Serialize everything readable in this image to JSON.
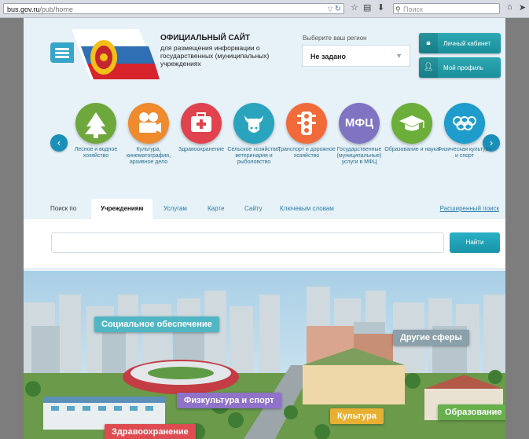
{
  "browser": {
    "url_domain": "bus.gov.ru",
    "url_path": "/pub/home",
    "search_placeholder": "Поиск"
  },
  "header": {
    "title": "ОФИЦИАЛЬНЫЙ САЙТ",
    "subtitle": "для размещения информации о государственных (муниципальных) учреждениях",
    "region_label": "Выберите ваш регион",
    "region_value": "Не задано",
    "cabinet_label": "Личный кабинет",
    "profile_label": "Мой профиль"
  },
  "categories": [
    {
      "label": "Лесное и водное хозяйство",
      "color": "#6ea83c",
      "icon": "tree-icon"
    },
    {
      "label": "Культура, кинематография, архивное дело",
      "color": "#ef8a2d",
      "icon": "camera-icon"
    },
    {
      "label": "Здравоохранение",
      "color": "#e0434e",
      "icon": "medkit-icon"
    },
    {
      "label": "Сельское хозяйство, ветеринария и рыболовство",
      "color": "#2aa4bd",
      "icon": "cow-icon"
    },
    {
      "label": "Транспорт и дорожное хозяйство",
      "color": "#f06a3a",
      "icon": "traffic-light-icon"
    },
    {
      "label": "Государственные (муниципальные) услуги в МФЦ",
      "color": "#7f73c2",
      "icon": "mfc-icon",
      "text": "МФЦ"
    },
    {
      "label": "Образование и наука",
      "color": "#6cae3a",
      "icon": "graduation-cap-icon"
    },
    {
      "label": "Физическая культура и спорт",
      "color": "#1e9ccb",
      "icon": "olympic-rings-icon"
    }
  ],
  "tabs": {
    "prefix": "Поиск по",
    "items": [
      "Учреждениям",
      "Услугам",
      "Карте",
      "Сайту",
      "Ключевым словам"
    ],
    "advanced": "Расширенный поиск"
  },
  "search": {
    "value": "",
    "button": "Найти"
  },
  "banner": {
    "labels": [
      "Социальное обеспечение",
      "Другие сферы",
      "Физкультура и спорт",
      "Культура",
      "Образование",
      "Здравоохранение"
    ]
  }
}
